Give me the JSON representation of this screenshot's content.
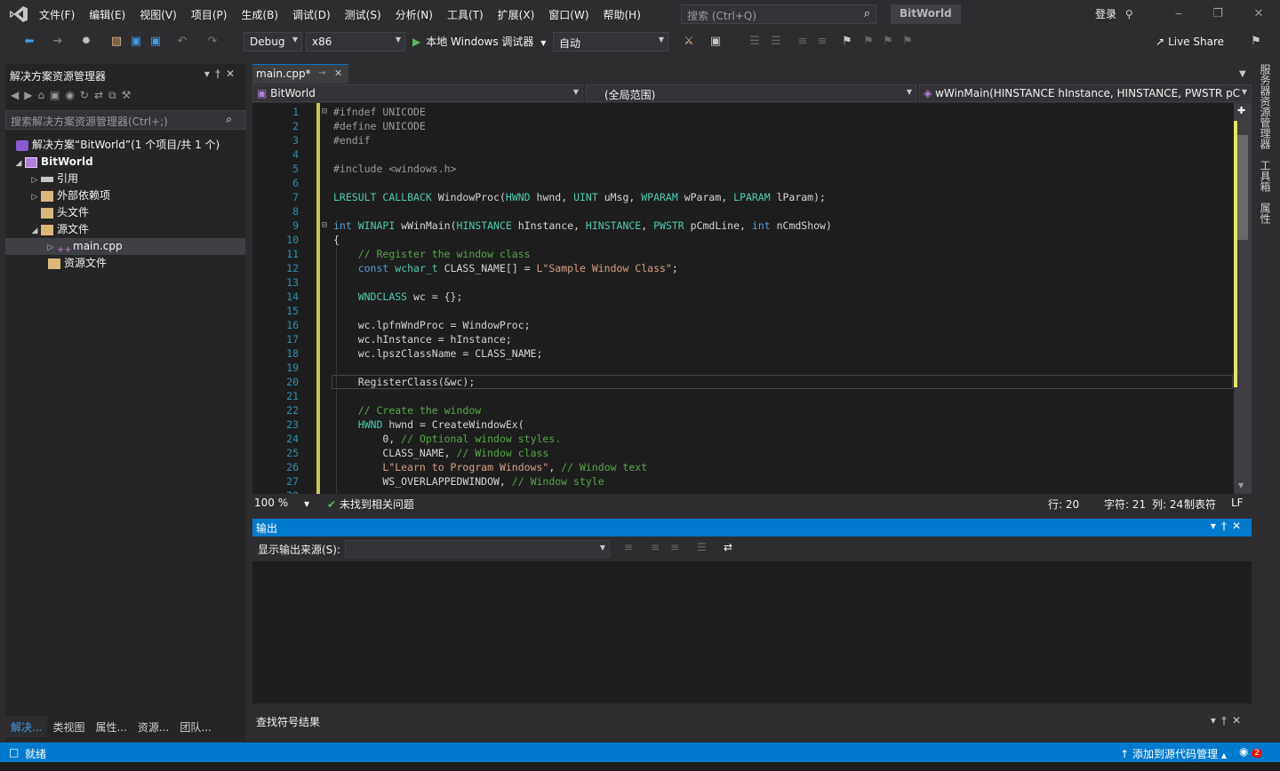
{
  "menu": [
    "文件(F)",
    "编辑(E)",
    "视图(V)",
    "项目(P)",
    "生成(B)",
    "调试(D)",
    "测试(S)",
    "分析(N)",
    "工具(T)",
    "扩展(X)",
    "窗口(W)",
    "帮助(H)"
  ],
  "search": {
    "placeholder": "搜索 (Ctrl+Q)"
  },
  "app_name": "BitWorld",
  "login": "登录",
  "toolbar": {
    "config": "Debug",
    "platform": "x86",
    "run_label": "本地 Windows 调试器",
    "auto": "自动",
    "live_share": "Live Share"
  },
  "solution_explorer": {
    "title": "解决方案资源管理器",
    "search_placeholder": "搜索解决方案资源管理器(Ctrl+;)",
    "items": [
      {
        "label": "解决方案“BitWorld”(1 个项目/共 1 个)"
      },
      {
        "label": "BitWorld"
      },
      {
        "label": "引用"
      },
      {
        "label": "外部依赖项"
      },
      {
        "label": "头文件"
      },
      {
        "label": "源文件"
      },
      {
        "label": "main.cpp"
      },
      {
        "label": "资源文件"
      }
    ]
  },
  "bottom_tabs": [
    "解决...",
    "类视图",
    "属性...",
    "资源...",
    "团队..."
  ],
  "editor": {
    "tab": "main.cpp*",
    "nav_project": "BitWorld",
    "nav_scope": "(全局范围)",
    "nav_func": "wWinMain(HINSTANCE hInstance, HINSTANCE, PWSTR pC",
    "lines": [
      {
        "n": "1",
        "t": "#ifndef UNICODE"
      },
      {
        "n": "2",
        "t": "#define UNICODE"
      },
      {
        "n": "3",
        "t": "#endif"
      },
      {
        "n": "4",
        "t": ""
      },
      {
        "n": "5",
        "t": "#include <windows.h>"
      },
      {
        "n": "6",
        "t": ""
      },
      {
        "n": "7",
        "t": "LRESULT CALLBACK WindowProc(HWND hwnd, UINT uMsg, WPARAM wParam, LPARAM lParam);"
      },
      {
        "n": "8",
        "t": ""
      },
      {
        "n": "9",
        "t": "int WINAPI wWinMain(HINSTANCE hInstance, HINSTANCE, PWSTR pCmdLine, int nCmdShow)"
      },
      {
        "n": "10",
        "t": "{"
      },
      {
        "n": "11",
        "t": "    // Register the window class"
      },
      {
        "n": "12",
        "t": "    const wchar_t CLASS_NAME[] = L\"Sample Window Class\";"
      },
      {
        "n": "13",
        "t": ""
      },
      {
        "n": "14",
        "t": "    WNDCLASS wc = {};"
      },
      {
        "n": "15",
        "t": ""
      },
      {
        "n": "16",
        "t": "    wc.lpfnWndProc = WindowProc;"
      },
      {
        "n": "17",
        "t": "    wc.hInstance = hInstance;"
      },
      {
        "n": "18",
        "t": "    wc.lpszClassName = CLASS_NAME;"
      },
      {
        "n": "19",
        "t": ""
      },
      {
        "n": "20",
        "t": "    RegisterClass(&wc);"
      },
      {
        "n": "21",
        "t": ""
      },
      {
        "n": "22",
        "t": "    // Create the window"
      },
      {
        "n": "23",
        "t": "    HWND hwnd = CreateWindowEx("
      },
      {
        "n": "24",
        "t": "        0, // Optional window styles."
      },
      {
        "n": "25",
        "t": "        CLASS_NAME, // Window class"
      },
      {
        "n": "26",
        "t": "        L\"Learn to Program Windows\", // Window text"
      },
      {
        "n": "27",
        "t": "        WS_OVERLAPPEDWINDOW, // Window style"
      },
      {
        "n": "28",
        "t": ""
      }
    ],
    "zoom": "100 %",
    "issues": "未找到相关问题",
    "line": "行: 20",
    "char": "字符: 21",
    "col": "列: 24",
    "tabs": "制表符",
    "eol": "LF"
  },
  "output": {
    "title": "输出",
    "source_label": "显示输出来源(S):",
    "source_value": ""
  },
  "find_symbols": {
    "title": "查找符号结果"
  },
  "side_tabs": [
    "服务器资源管理器",
    "工具箱",
    "属性"
  ],
  "status": {
    "ready": "就绪",
    "source_control": "添加到源代码管理",
    "notifications": "2"
  },
  "colors": {
    "accent": "#007acc",
    "background": "#2d2d30",
    "editor": "#1e1e1e",
    "line_number": "#2b91af"
  }
}
